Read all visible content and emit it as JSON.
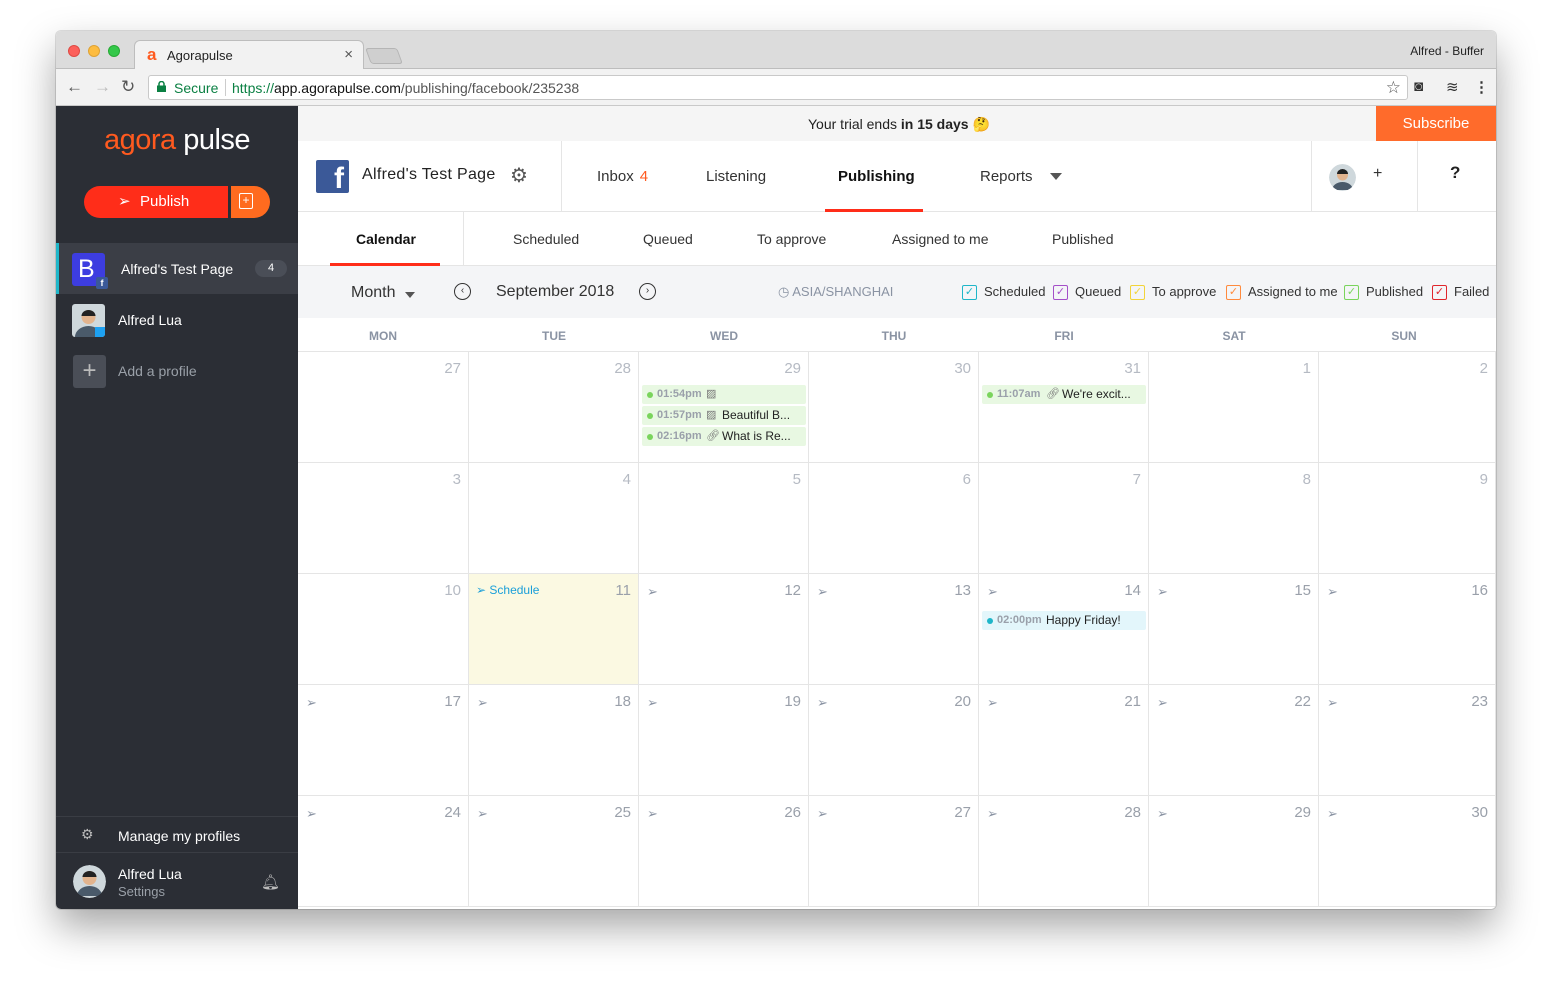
{
  "browser": {
    "tab_title": "Agorapulse",
    "profile_name": "Alfred - Buffer",
    "secure_label": "Secure",
    "url_scheme": "https://",
    "url_host": "app.agorapulse.com",
    "url_path": "/publishing/facebook/235238"
  },
  "sidebar": {
    "logo_part1": "agora",
    "logo_part2": "pulse",
    "publish_label": "Publish",
    "profiles": [
      {
        "label": "Alfred's Test Page",
        "badge": "4",
        "network": "facebook",
        "initial": "B"
      },
      {
        "label": "Alfred Lua",
        "network": "twitter"
      }
    ],
    "add_profile_label": "Add a profile",
    "manage_label": "Manage my profiles",
    "user_name": "Alfred Lua",
    "user_settings": "Settings"
  },
  "trial": {
    "prefix": "Your trial ends ",
    "emphasis": "in 15 days",
    "emoji": "🤔",
    "subscribe_label": "Subscribe"
  },
  "topnav": {
    "page_name": "Alfred's Test Page",
    "inbox_label": "Inbox",
    "inbox_count": "4",
    "listening_label": "Listening",
    "publishing_label": "Publishing",
    "reports_label": "Reports",
    "plus_label": "+",
    "help_label": "?"
  },
  "subnav": {
    "calendar": "Calendar",
    "scheduled": "Scheduled",
    "queued": "Queued",
    "to_approve": "To approve",
    "assigned": "Assigned to me",
    "published": "Published"
  },
  "toolbar": {
    "view": "Month",
    "month": "September 2018",
    "timezone": "ASIA/SHANGHAI",
    "legend": [
      {
        "label": "Scheduled",
        "color": "#1fb6c9"
      },
      {
        "label": "Queued",
        "color": "#a44fc8"
      },
      {
        "label": "To approve",
        "color": "#f2d43a"
      },
      {
        "label": "Assigned to me",
        "color": "#ff8a3d"
      },
      {
        "label": "Published",
        "color": "#7ad45c"
      },
      {
        "label": "Failed",
        "color": "#e0262c"
      }
    ]
  },
  "calendar": {
    "days": [
      "MON",
      "TUE",
      "WED",
      "THU",
      "FRI",
      "SAT",
      "SUN"
    ],
    "schedule_label": "Schedule",
    "weeks": [
      [
        "27",
        "28",
        "29",
        "30",
        "31",
        "1",
        "2"
      ],
      [
        "3",
        "4",
        "5",
        "6",
        "7",
        "8",
        "9"
      ],
      [
        "10",
        "11",
        "12",
        "13",
        "14",
        "15",
        "16"
      ],
      [
        "17",
        "18",
        "19",
        "20",
        "21",
        "22",
        "23"
      ],
      [
        "24",
        "25",
        "26",
        "27",
        "28",
        "29",
        "30"
      ]
    ],
    "posts": {
      "wed_29": [
        {
          "time": "01:54pm",
          "type": "image",
          "text": ""
        },
        {
          "time": "01:57pm",
          "type": "image",
          "text": "Beautiful B..."
        },
        {
          "time": "02:16pm",
          "type": "link",
          "text": "What is Re..."
        }
      ],
      "fri_31": [
        {
          "time": "11:07am",
          "type": "link",
          "text": "We're excit..."
        }
      ],
      "fri_14": [
        {
          "time": "02:00pm",
          "type": "none",
          "text": "Happy Friday!"
        }
      ]
    }
  }
}
